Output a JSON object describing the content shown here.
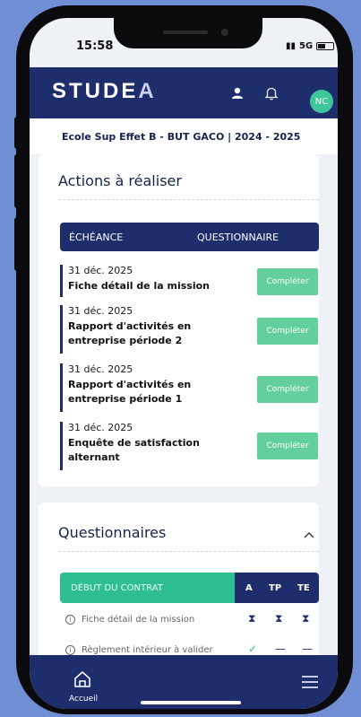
{
  "status": {
    "time": "15:58",
    "network": "5G"
  },
  "header": {
    "logo": "STUDE",
    "logo_tail": "A",
    "avatar_initials": "NC"
  },
  "school": {
    "label": "Ecole Sup Effet B - BUT GACO | 2024 - 2025"
  },
  "actions": {
    "title": "Actions à réaliser",
    "col_deadline": "ÉCHÉANCE",
    "col_form": "QUESTIONNAIRE",
    "button_label": "Compléter",
    "items": [
      {
        "date": "31 déc. 2025",
        "title": "Fiche détail de la mission"
      },
      {
        "date": "31 déc. 2025",
        "title": "Rapport d'activités en entreprise période 2"
      },
      {
        "date": "31 déc. 2025",
        "title": "Rapport d'activités en entreprise période 1"
      },
      {
        "date": "31 déc. 2025",
        "title": "Enquête de satisfaction alternant"
      }
    ]
  },
  "questionnaires": {
    "title": "Questionnaires",
    "section": "DÉBUT DU CONTRAT",
    "cols": [
      "A",
      "TP",
      "TE"
    ],
    "rows": [
      {
        "label": "Fiche détail de la mission",
        "cells": [
          "⧗",
          "⧗",
          "⧗"
        ]
      },
      {
        "label": "Règlement intérieur à valider",
        "cells": [
          "✓",
          "—",
          "—"
        ]
      }
    ]
  },
  "nav": {
    "home_label": "Accueil"
  },
  "colors": {
    "navy": "#1e2d6b",
    "green": "#2fbd92",
    "button": "#63cf9d"
  }
}
